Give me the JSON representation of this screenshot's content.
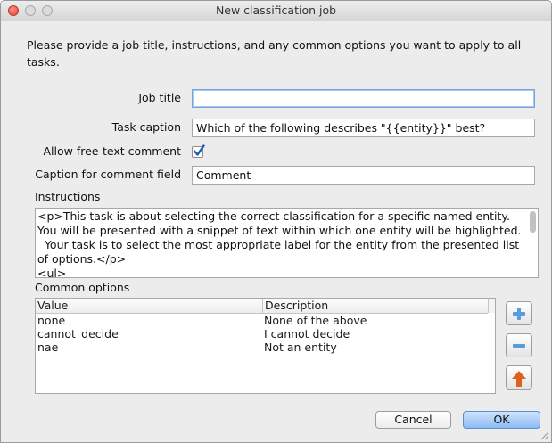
{
  "window": {
    "title": "New classification job"
  },
  "intro": "Please provide a job title, instructions, and any common options you want to apply to all tasks.",
  "form": {
    "job_title": {
      "label": "Job title",
      "value": ""
    },
    "task_caption": {
      "label": "Task caption",
      "value": "Which of the following describes \"{{entity}}\" best?"
    },
    "allow_comment": {
      "label": "Allow free-text comment",
      "checked": true
    },
    "comment_caption": {
      "label": "Caption for comment field",
      "value": "Comment"
    }
  },
  "instructions": {
    "label": "Instructions",
    "text": "<p>This task is about selecting the correct classification for a specific named entity. You will be presented with a snippet of text within which one entity will be highlighted.\n  Your task is to select the most appropriate label for the entity from the presented list of options.</p>\n<ul>"
  },
  "common_options": {
    "label": "Common options",
    "columns": [
      "Value",
      "Description"
    ],
    "rows": [
      {
        "value": "none",
        "description": "None of the above"
      },
      {
        "value": "cannot_decide",
        "description": "I cannot decide"
      },
      {
        "value": "nae",
        "description": "Not an entity"
      }
    ]
  },
  "side_buttons": {
    "add": "plus-icon",
    "remove": "minus-icon",
    "move_up": "arrow-up-icon"
  },
  "buttons": {
    "cancel": "Cancel",
    "ok": "OK"
  },
  "colors": {
    "accent": "#3b8ad9",
    "arrow": "#e0611a",
    "close": "#e0443a"
  }
}
